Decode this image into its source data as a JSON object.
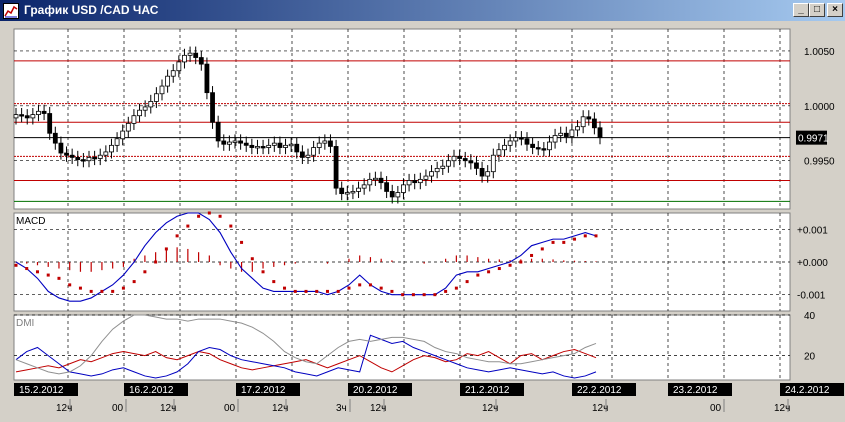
{
  "window": {
    "title": "График USD /CAD  ЧАС",
    "minimize_label": "_",
    "maximize_label": "□",
    "close_label": "×"
  },
  "colors": {
    "chart_background": "#ffffff",
    "frame_background": "#d4d0c8",
    "red_line": "#c00000",
    "green_line": "#007000",
    "macd_line": "#0000c0",
    "signal_dots": "#c00000",
    "histogram": "#c00000",
    "dmi_plus": "#c00000",
    "dmi_minus": "#0000c0",
    "adx": "#909090",
    "date_label_bg": "#000000",
    "date_label_text": "#ffffff"
  },
  "chart_data": [
    {
      "type": "candlestick",
      "y_ticks": [
        1.005,
        1.0,
        0.995
      ],
      "y_tick_labels": [
        "1.0050",
        "1.0000",
        "0.9950"
      ],
      "ylim": [
        0.9906,
        1.007
      ],
      "current_price_label": "0.9971",
      "current_price": 0.9971,
      "levels": [
        {
          "value": 1.0041,
          "color": "#c00000",
          "style": "solid"
        },
        {
          "value": 1.0002,
          "color": "#c00000",
          "style": "dashed"
        },
        {
          "value": 0.9985,
          "color": "#c00000",
          "style": "solid"
        },
        {
          "value": 0.9954,
          "color": "#c00000",
          "style": "dashed"
        },
        {
          "value": 0.9932,
          "color": "#c00000",
          "style": "solid"
        },
        {
          "value": 0.9913,
          "color": "#007000",
          "style": "solid"
        },
        {
          "value": 0.9971,
          "color": "#000000",
          "style": "solid"
        }
      ],
      "prices": [
        0.9992,
        0.9991,
        0.9989,
        0.9992,
        0.9995,
        0.9993,
        0.9975,
        0.9966,
        0.9957,
        0.9955,
        0.9953,
        0.9951,
        0.995,
        0.9953,
        0.9952,
        0.9955,
        0.9958,
        0.9964,
        0.997,
        0.9977,
        0.9984,
        0.9991,
        0.9996,
        0.9999,
        1.0004,
        1.0011,
        1.0018,
        1.0027,
        1.0032,
        1.004,
        1.0046,
        1.0048,
        1.0044,
        1.0038,
        1.0012,
        0.9985,
        0.9968,
        0.9965,
        0.9967,
        0.9968,
        0.9966,
        0.9964,
        0.9962,
        0.9963,
        0.9962,
        0.9964,
        0.9966,
        0.9962,
        0.9964,
        0.9965,
        0.9958,
        0.9953,
        0.9955,
        0.9962,
        0.9966,
        0.9968,
        0.9963,
        0.9925,
        0.992,
        0.9921,
        0.9922,
        0.9925,
        0.9928,
        0.9933,
        0.9934,
        0.993,
        0.9922,
        0.9917,
        0.9921,
        0.9928,
        0.9932,
        0.993,
        0.9933,
        0.9936,
        0.994,
        0.9943,
        0.9945,
        0.995,
        0.9954,
        0.9952,
        0.995,
        0.9948,
        0.9943,
        0.9936,
        0.994,
        0.9955,
        0.996,
        0.9964,
        0.9968,
        0.9971,
        0.997,
        0.9965,
        0.9962,
        0.9961,
        0.996,
        0.9967,
        0.9973,
        0.9975,
        0.9972,
        0.9978,
        0.9981,
        0.999,
        0.9988,
        0.998,
        0.9971
      ]
    },
    {
      "type": "line",
      "title": "MACD",
      "y_ticks": [
        0.001,
        0.0,
        -0.001
      ],
      "y_tick_labels": [
        "+0.001",
        "+0.000",
        "-0.001"
      ],
      "ylim": [
        -0.0015,
        0.0015
      ],
      "series": [
        {
          "values": [
            0.0,
            -0.0002,
            -0.0005,
            -0.0009,
            -0.0011,
            -0.0012,
            -0.0012,
            -0.0011,
            -0.0009,
            -0.0007,
            -0.0004,
            0.0,
            0.0005,
            0.0009,
            0.0012,
            0.0014,
            0.0015,
            0.0015,
            0.0013,
            0.0009,
            0.0003,
            -0.0002,
            -0.0005,
            -0.0008,
            -0.0009,
            -0.0009,
            -0.0009,
            -0.0009,
            -0.0009,
            -0.001,
            -0.0009,
            -0.0007,
            -0.0004,
            -0.0007,
            -0.0009,
            -0.001,
            -0.001,
            -0.001,
            -0.001,
            -0.001,
            -0.0008,
            -0.0004,
            -0.0003,
            -0.0003,
            -0.0002,
            -0.0001,
            0.0,
            0.0002,
            0.0005,
            0.0006,
            0.0007,
            0.0007,
            0.0008,
            0.0009,
            0.0008
          ],
          "color": "#0000c0"
        },
        {
          "values": [
            -0.0001,
            -0.0002,
            -0.0003,
            -0.0004,
            -0.0005,
            -0.0007,
            -0.0008,
            -0.0009,
            -0.0009,
            -0.0009,
            -0.0008,
            -0.0006,
            -0.0003,
            0.0,
            0.0004,
            0.0008,
            0.0011,
            0.0014,
            0.0015,
            0.0014,
            0.0011,
            0.0006,
            0.0001,
            -0.0003,
            -0.0006,
            -0.0008,
            -0.0009,
            -0.0009,
            -0.0009,
            -0.0009,
            -0.0009,
            -0.0008,
            -0.0007,
            -0.0007,
            -0.0008,
            -0.0009,
            -0.001,
            -0.001,
            -0.001,
            -0.001,
            -0.0009,
            -0.0008,
            -0.0006,
            -0.0004,
            -0.0003,
            -0.0002,
            -0.0001,
            0.0,
            0.0002,
            0.0004,
            0.0006,
            0.0006,
            0.0007,
            0.0008,
            0.0008
          ],
          "color": "#c00000"
        }
      ],
      "histogram": [
        0.0,
        -5e-05,
        -0.0001,
        -0.00015,
        -0.0002,
        -0.00025,
        -0.0003,
        -0.0003,
        -0.00025,
        -0.0002,
        -0.00015,
        0.0001,
        0.0002,
        0.0003,
        0.0004,
        0.00045,
        0.0004,
        0.0003,
        0.0002,
        -0.0001,
        -0.0002,
        -0.0003,
        -0.0003,
        -0.0002,
        -0.00015,
        -0.0001,
        -5e-05,
        0.0,
        0.0,
        -5e-05,
        0.0,
        0.0001,
        0.0002,
        0.00015,
        0.0001,
        5e-05,
        0.0,
        0.0,
        -5e-05,
        0.0,
        0.0001,
        0.0002,
        0.0002,
        0.00015,
        0.0001,
        8e-05,
        6e-05,
        8e-05,
        0.0001,
        0.0001,
        8e-05,
        5e-05,
        4e-05,
        3e-05,
        2e-05
      ]
    },
    {
      "type": "line",
      "title": "DMI",
      "y_ticks": [
        40,
        20
      ],
      "y_tick_labels": [
        "40",
        "20"
      ],
      "ylim": [
        8,
        40
      ],
      "series": [
        {
          "values": [
            12,
            13,
            14,
            15,
            14,
            16,
            18,
            17,
            19,
            21,
            22,
            21,
            20,
            22,
            19,
            18,
            20,
            22,
            21,
            18,
            16,
            14,
            13,
            14,
            15,
            16,
            17,
            18,
            16,
            14,
            16,
            18,
            20,
            17,
            14,
            12,
            15,
            18,
            20,
            19,
            17,
            18,
            21,
            20,
            22,
            19,
            16,
            20,
            21,
            18,
            20,
            22,
            23,
            21,
            19
          ],
          "color": "#c00000"
        },
        {
          "values": [
            18,
            22,
            24,
            20,
            16,
            12,
            11,
            10,
            11,
            13,
            14,
            12,
            10,
            9,
            10,
            12,
            16,
            22,
            24,
            23,
            20,
            18,
            17,
            16,
            15,
            14,
            12,
            11,
            10,
            12,
            14,
            13,
            12,
            30,
            28,
            26,
            27,
            24,
            22,
            20,
            18,
            16,
            14,
            13,
            12,
            13,
            14,
            13,
            12,
            11,
            12,
            10,
            9,
            10,
            12
          ],
          "color": "#0000c0"
        },
        {
          "values": [
            18,
            16,
            14,
            12,
            11,
            12,
            15,
            20,
            27,
            33,
            37,
            40,
            40,
            39,
            38,
            38,
            37,
            38,
            38,
            38,
            37,
            36,
            34,
            31,
            27,
            22,
            19,
            17,
            16,
            20,
            24,
            27,
            28,
            27,
            28,
            29,
            29,
            28,
            27,
            24,
            22,
            21,
            19,
            18,
            17,
            17,
            16,
            16,
            17,
            18,
            19,
            20,
            21,
            24,
            26
          ],
          "color": "#909090"
        }
      ]
    }
  ],
  "x_axis": {
    "dates": [
      "15.2.2012",
      "16.2.2012",
      "17.2.2012",
      "20.2.2012",
      "21.2.2012",
      "22.2.2012",
      "23.2.2012",
      "24.2.2012"
    ],
    "hours": [
      "12ч",
      "00",
      "12ч",
      "00",
      "12ч",
      "3ч",
      "12ч",
      "12ч",
      "12ч",
      "00",
      "12ч"
    ]
  }
}
